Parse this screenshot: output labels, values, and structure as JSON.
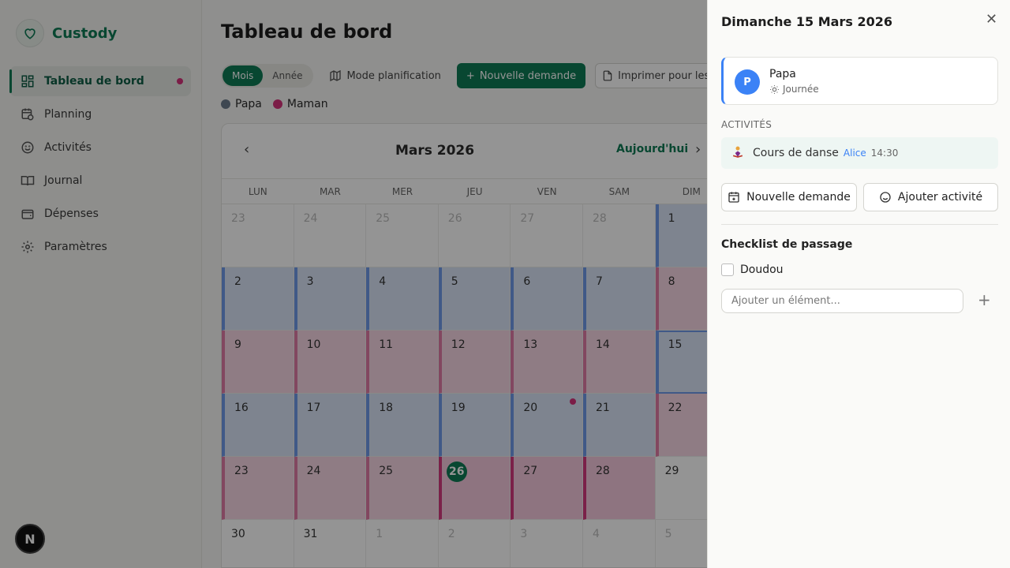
{
  "brand": {
    "name": "Custody"
  },
  "nav": {
    "items": [
      {
        "label": "Tableau de bord",
        "icon": "dashboard-icon"
      },
      {
        "label": "Planning",
        "icon": "calendar-clock-icon"
      },
      {
        "label": "Activités",
        "icon": "smile-icon"
      },
      {
        "label": "Journal",
        "icon": "book-icon"
      },
      {
        "label": "Dépenses",
        "icon": "wallet-icon"
      },
      {
        "label": "Paramètres",
        "icon": "gear-icon"
      }
    ]
  },
  "badge": "N",
  "page": {
    "title": "Tableau de bord",
    "view_toggle": {
      "month": "Mois",
      "year": "Année",
      "selected": "Mois"
    },
    "planning_mode": "Mode planification",
    "new_request": "Nouvelle demande",
    "print": "Imprimer pour les en",
    "legend": [
      {
        "label": "Papa",
        "color": "#6b7b8c"
      },
      {
        "label": "Maman",
        "color": "#d4337a"
      }
    ]
  },
  "calendar": {
    "title": "Mars 2026",
    "today_label": "Aujourd'hui",
    "days": [
      "LUN",
      "MAR",
      "MER",
      "JEU",
      "VEN",
      "SAM",
      "DIM"
    ],
    "weeks": [
      [
        "23",
        "24",
        "25",
        "26",
        "27",
        "28",
        "1"
      ],
      [
        "2",
        "3",
        "4",
        "5",
        "6",
        "7",
        "8"
      ],
      [
        "9",
        "10",
        "11",
        "12",
        "13",
        "14",
        "15"
      ],
      [
        "16",
        "17",
        "18",
        "19",
        "20",
        "21",
        "22"
      ],
      [
        "23",
        "24",
        "25",
        "26",
        "27",
        "28",
        "29"
      ],
      [
        "30",
        "31",
        "1",
        "2",
        "3",
        "4",
        "5"
      ]
    ]
  },
  "drawer": {
    "title": "Dimanche 15 Mars 2026",
    "parent": {
      "initial": "P",
      "name": "Papa",
      "period": "Journée"
    },
    "activities_label": "ACTIVITÉS",
    "activity": {
      "name": "Cours de danse",
      "child": "Alice",
      "time": "14:30"
    },
    "new_request": "Nouvelle demande",
    "add_activity": "Ajouter activité",
    "checklist_title": "Checklist de passage",
    "checklist_items": [
      "Doudou"
    ],
    "add_placeholder": "Ajouter un élément..."
  },
  "colors": {
    "accent": "#0f7a55",
    "papa": "#3b82f6",
    "maman": "#d4337a"
  }
}
